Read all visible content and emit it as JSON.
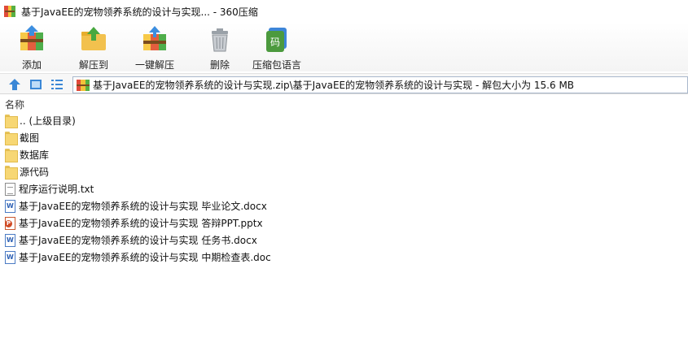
{
  "window": {
    "title": "基于JavaEE的宠物领养系统的设计与实现... - 360压缩"
  },
  "toolbar": {
    "add_label": "添加",
    "extract_to_label": "解压到",
    "one_click_extract_label": "一键解压",
    "delete_label": "删除",
    "comment_label": "压缩包语言"
  },
  "address": {
    "path": "基于JavaEE的宠物领养系统的设计与实现.zip\\基于JavaEE的宠物领养系统的设计与实现 - 解包大小为 15.6 MB"
  },
  "list": {
    "column_name": "名称",
    "items": [
      {
        "name": ".. (上级目录)",
        "type": "folder"
      },
      {
        "name": "截图",
        "type": "folder"
      },
      {
        "name": "数据库",
        "type": "folder"
      },
      {
        "name": "源代码",
        "type": "folder"
      },
      {
        "name": "程序运行说明.txt",
        "type": "txt"
      },
      {
        "name": "基于JavaEE的宠物领养系统的设计与实现 毕业论文.docx",
        "type": "word"
      },
      {
        "name": "基于JavaEE的宠物领养系统的设计与实现 答辩PPT.pptx",
        "type": "ppt"
      },
      {
        "name": "基于JavaEE的宠物领养系统的设计与实现 任务书.docx",
        "type": "word"
      },
      {
        "name": "基于JavaEE的宠物领养系统的设计与实现 中期检查表.doc",
        "type": "word"
      }
    ]
  }
}
